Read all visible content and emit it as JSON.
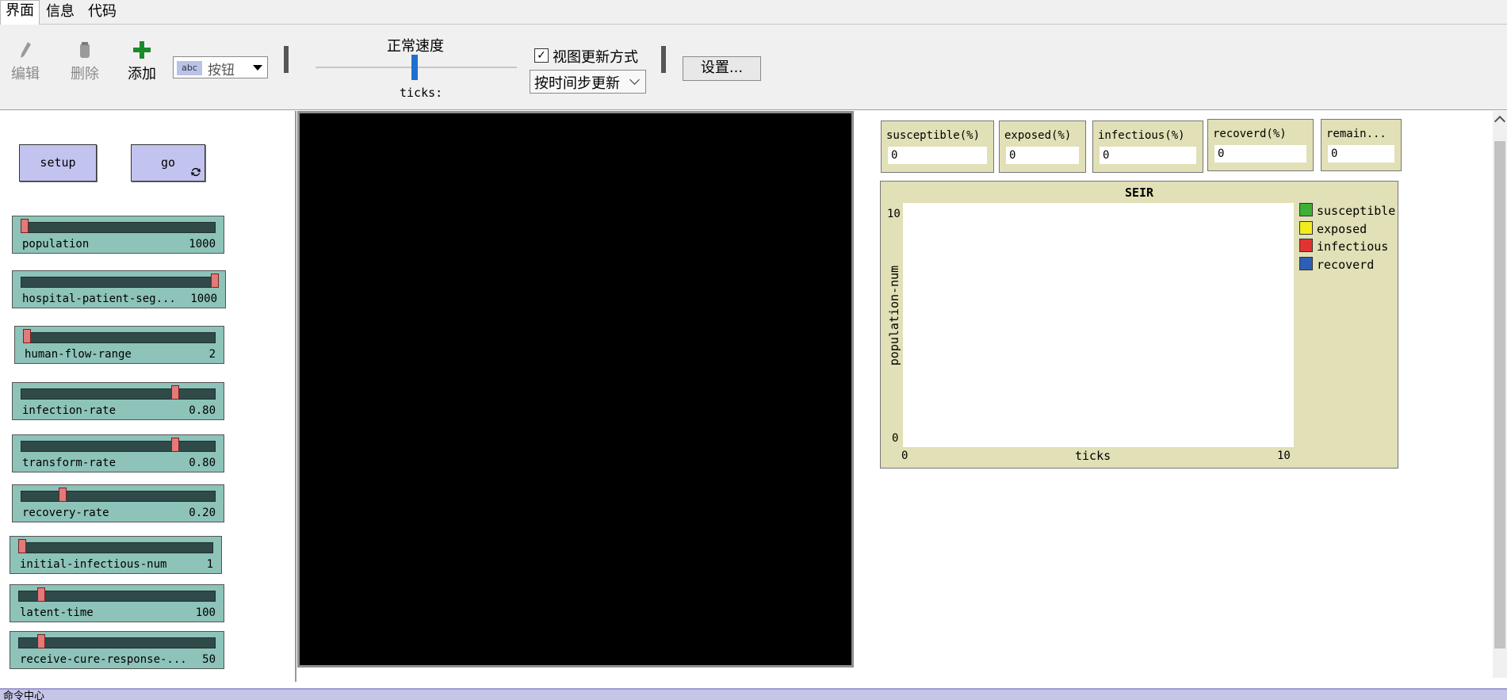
{
  "tabs": [
    "界面",
    "信息",
    "代码"
  ],
  "toolbar": {
    "edit_label": "编辑",
    "delete_label": "删除",
    "add_label": "添加",
    "widget_type": "按钮",
    "widget_icon_text": "abc",
    "speed_label": "正常速度",
    "ticks_label": "ticks:",
    "view_update_label": "视图更新方式",
    "view_update_checked": true,
    "update_mode": "按时间步更新",
    "settings_label": "设置..."
  },
  "buttons": {
    "setup": "setup",
    "go": "go"
  },
  "sliders": [
    {
      "name": "population",
      "value": "1000",
      "fraction": 0.0
    },
    {
      "name": "hospital-patient-seg...",
      "value": "1000",
      "fraction": 1.0
    },
    {
      "name": "human-flow-range",
      "value": "2",
      "fraction": 0.0
    },
    {
      "name": "infection-rate",
      "value": "0.80",
      "fraction": 0.8
    },
    {
      "name": "transform-rate",
      "value": "0.80",
      "fraction": 0.8
    },
    {
      "name": "recovery-rate",
      "value": "0.20",
      "fraction": 0.2
    },
    {
      "name": "initial-infectious-num",
      "value": "1",
      "fraction": 0.0
    },
    {
      "name": "latent-time",
      "value": "100",
      "fraction": 0.1
    },
    {
      "name": "receive-cure-response-...",
      "value": "50",
      "fraction": 0.1
    }
  ],
  "monitors": [
    {
      "name": "susceptible(%)",
      "value": "0"
    },
    {
      "name": "exposed(%)",
      "value": "0"
    },
    {
      "name": "infectious(%)",
      "value": "0"
    },
    {
      "name": "recoverd(%)",
      "value": "0"
    },
    {
      "name": "remain...",
      "value": "0"
    }
  ],
  "plot": {
    "title": "SEIR",
    "xlabel": "ticks",
    "ylabel": "population-num",
    "xmin": "0",
    "xmax": "10",
    "ymin": "0",
    "ymax": "10",
    "legend": [
      {
        "name": "susceptible",
        "color": "#3db035"
      },
      {
        "name": "exposed",
        "color": "#f2ec1e"
      },
      {
        "name": "infectious",
        "color": "#e33232"
      },
      {
        "name": "recoverd",
        "color": "#2c5fb5"
      }
    ]
  },
  "command_center": {
    "label": "命令中心"
  }
}
